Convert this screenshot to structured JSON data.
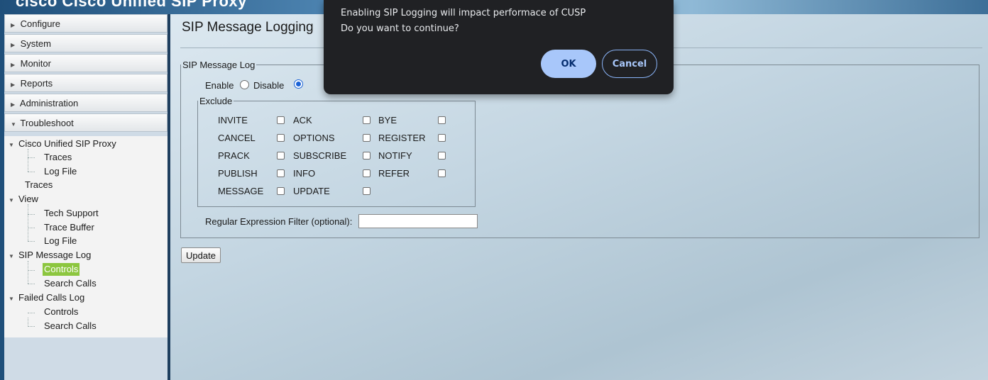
{
  "app": {
    "brand": "cisco Cisco Unified SIP Proxy"
  },
  "sidebar": {
    "menu": [
      {
        "label": "Configure",
        "caret": "▶"
      },
      {
        "label": "System",
        "caret": "▶"
      },
      {
        "label": "Monitor",
        "caret": "▶"
      },
      {
        "label": "Reports",
        "caret": "▶"
      },
      {
        "label": "Administration",
        "caret": "▶"
      },
      {
        "label": "Troubleshoot",
        "caret": "▼"
      }
    ],
    "tree": {
      "cusp": "Cisco Unified SIP Proxy",
      "cusp_traces": "Traces",
      "cusp_logfile": "Log File",
      "traces": "Traces",
      "view": "View",
      "tech_support": "Tech Support",
      "trace_buffer": "Trace Buffer",
      "view_logfile": "Log File",
      "sip_message_log": "SIP Message Log",
      "sip_controls": "Controls",
      "sip_search": "Search Calls",
      "failed_calls_log": "Failed Calls Log",
      "failed_controls": "Controls",
      "failed_search": "Search Calls"
    },
    "expander_open": "▼"
  },
  "main": {
    "title": "SIP Message Logging",
    "log_legend": "SIP Message Log",
    "enable_label": "Enable",
    "disable_label": "Disable",
    "selected": "Disable",
    "exclude_legend": "Exclude",
    "exclude_items": [
      "INVITE",
      "ACK",
      "BYE",
      "CANCEL",
      "OPTIONS",
      "REGISTER",
      "PRACK",
      "SUBSCRIBE",
      "NOTIFY",
      "PUBLISH",
      "INFO",
      "REFER",
      "MESSAGE",
      "UPDATE"
    ],
    "regex_label": "Regular Expression Filter (optional):",
    "regex_value": "",
    "update_label": "Update"
  },
  "dialog": {
    "line1": "Enabling SIP Logging will impact performace of CUSP",
    "line2": "Do you want to continue?",
    "ok": "OK",
    "cancel": "Cancel"
  }
}
